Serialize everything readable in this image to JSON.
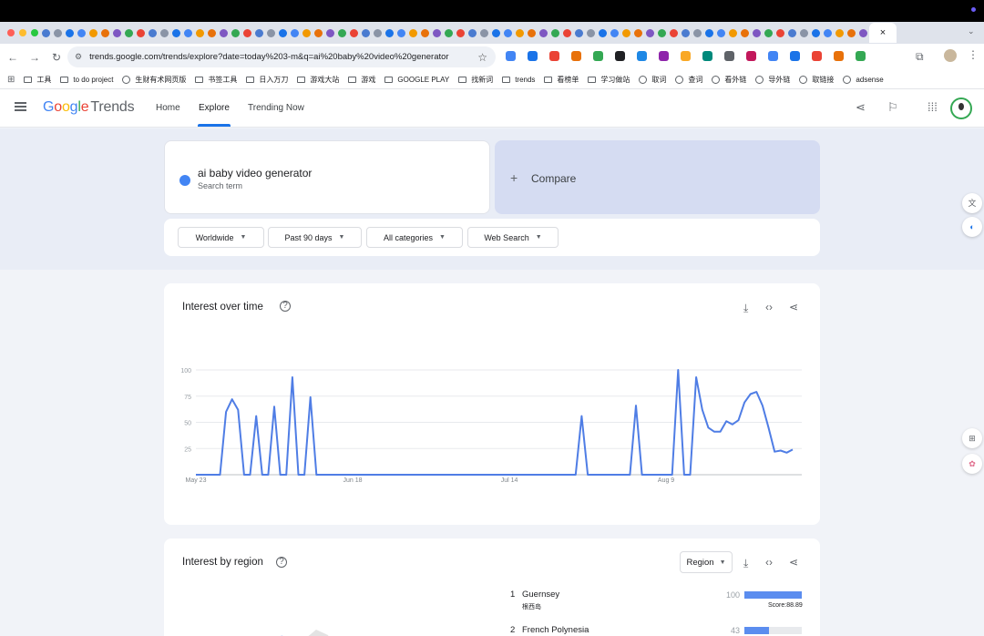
{
  "browser": {
    "url": "trends.google.com/trends/explore?date=today%203-m&q=ai%20baby%20video%20generator",
    "active_tab_close": "×"
  },
  "bookmarks": [
    "工具",
    "to do project",
    "生财有术网页版",
    "书签工具",
    "日入万刀",
    "游戏大站",
    "游戏",
    "GOOGLE PLAY",
    "找新词",
    "trends",
    "看榜单",
    "学习做站",
    "取词",
    "查词",
    "看外链",
    "导外链",
    "取链接",
    "adsense"
  ],
  "header": {
    "logo_google": "Google",
    "logo_trends": "Trends",
    "nav": [
      "Home",
      "Explore",
      "Trending Now"
    ]
  },
  "search": {
    "term": "ai baby video generator",
    "term_sub": "Search term",
    "compare_label": "Compare",
    "term_color": "#4285f4"
  },
  "filters": [
    "Worldwide",
    "Past 90 days",
    "All categories",
    "Web Search"
  ],
  "interest_over_time": {
    "title": "Interest over time"
  },
  "chart_data": {
    "type": "line",
    "title": "Interest over time",
    "ylim": [
      0,
      100
    ],
    "yticks": [
      "100",
      "75",
      "50",
      "25"
    ],
    "xticks": [
      "May 23",
      "Jun 18",
      "Jul 14",
      "Aug 9"
    ],
    "series": [
      {
        "color": "#4f7de5",
        "values": [
          0,
          0,
          0,
          0,
          0,
          60,
          72,
          62,
          0,
          0,
          56,
          0,
          0,
          65,
          0,
          0,
          93,
          0,
          0,
          74,
          0,
          0,
          0,
          0,
          0,
          0,
          0,
          0,
          0,
          0,
          0,
          0,
          0,
          0,
          0,
          0,
          0,
          0,
          0,
          0,
          0,
          0,
          0,
          0,
          0,
          0,
          0,
          0,
          0,
          0,
          0,
          0,
          0,
          0,
          0,
          0,
          0,
          0,
          0,
          0,
          0,
          0,
          0,
          0,
          56,
          0,
          0,
          0,
          0,
          0,
          0,
          0,
          0,
          66,
          0,
          0,
          0,
          0,
          0,
          0,
          100,
          0,
          0,
          93,
          62,
          45,
          41,
          41,
          51,
          48,
          52,
          69,
          77,
          79,
          66,
          45,
          22,
          23,
          21,
          24
        ]
      }
    ]
  },
  "interest_by_region": {
    "title": "Interest by region",
    "select": "Region",
    "rows": [
      {
        "rank": "1",
        "name": "Guernsey",
        "sub": "根西岛",
        "score": "100",
        "score_note": "Score:88.89",
        "fraction": 1.0
      },
      {
        "rank": "2",
        "name": "French Polynesia",
        "sub": "",
        "score": "43",
        "score_note": "",
        "fraction": 0.43
      }
    ]
  }
}
